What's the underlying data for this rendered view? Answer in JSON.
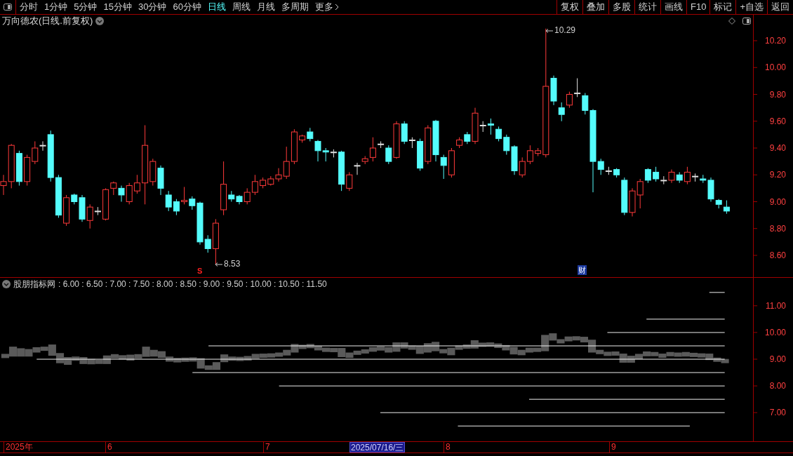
{
  "toolbar": {
    "periods": [
      {
        "label": "分时",
        "selected": false
      },
      {
        "label": "1分钟",
        "selected": false
      },
      {
        "label": "5分钟",
        "selected": false
      },
      {
        "label": "15分钟",
        "selected": false
      },
      {
        "label": "30分钟",
        "selected": false
      },
      {
        "label": "60分钟",
        "selected": false
      },
      {
        "label": "日线",
        "selected": true
      },
      {
        "label": "周线",
        "selected": false
      },
      {
        "label": "月线",
        "selected": false
      },
      {
        "label": "多周期",
        "selected": false
      }
    ],
    "more": "更多",
    "actions": [
      "复权",
      "叠加",
      "多股",
      "统计",
      "画线",
      "F10",
      "标记",
      "+自选",
      "返回"
    ]
  },
  "chart_title": "万向德农(日线.前复权)",
  "main_chart": {
    "y_ticks": [
      "10.20",
      "10.00",
      "9.80",
      "9.60",
      "9.40",
      "9.20",
      "9.00",
      "8.80",
      "8.60"
    ],
    "high_label": "10.29",
    "low_label": "8.53",
    "signal_mark": "S",
    "event_badge": "财"
  },
  "indicator": {
    "name": "股朋指标网",
    "legend": ": 6.00 : 6.50 : 7.00 : 7.50 : 8.00 : 8.50 : 9.00 : 9.50 : 10.00 : 10.50 : 11.50",
    "y_ticks": [
      "11.00",
      "10.00",
      "9.00",
      "8.00",
      "7.00"
    ]
  },
  "time_axis": [
    {
      "label": "2025年",
      "selected": false
    },
    {
      "label": "6",
      "selected": false
    },
    {
      "label": "7",
      "selected": false
    },
    {
      "label": "2025/07/16/三",
      "selected": true
    },
    {
      "label": "8",
      "selected": false
    },
    {
      "label": "9",
      "selected": false
    }
  ]
}
